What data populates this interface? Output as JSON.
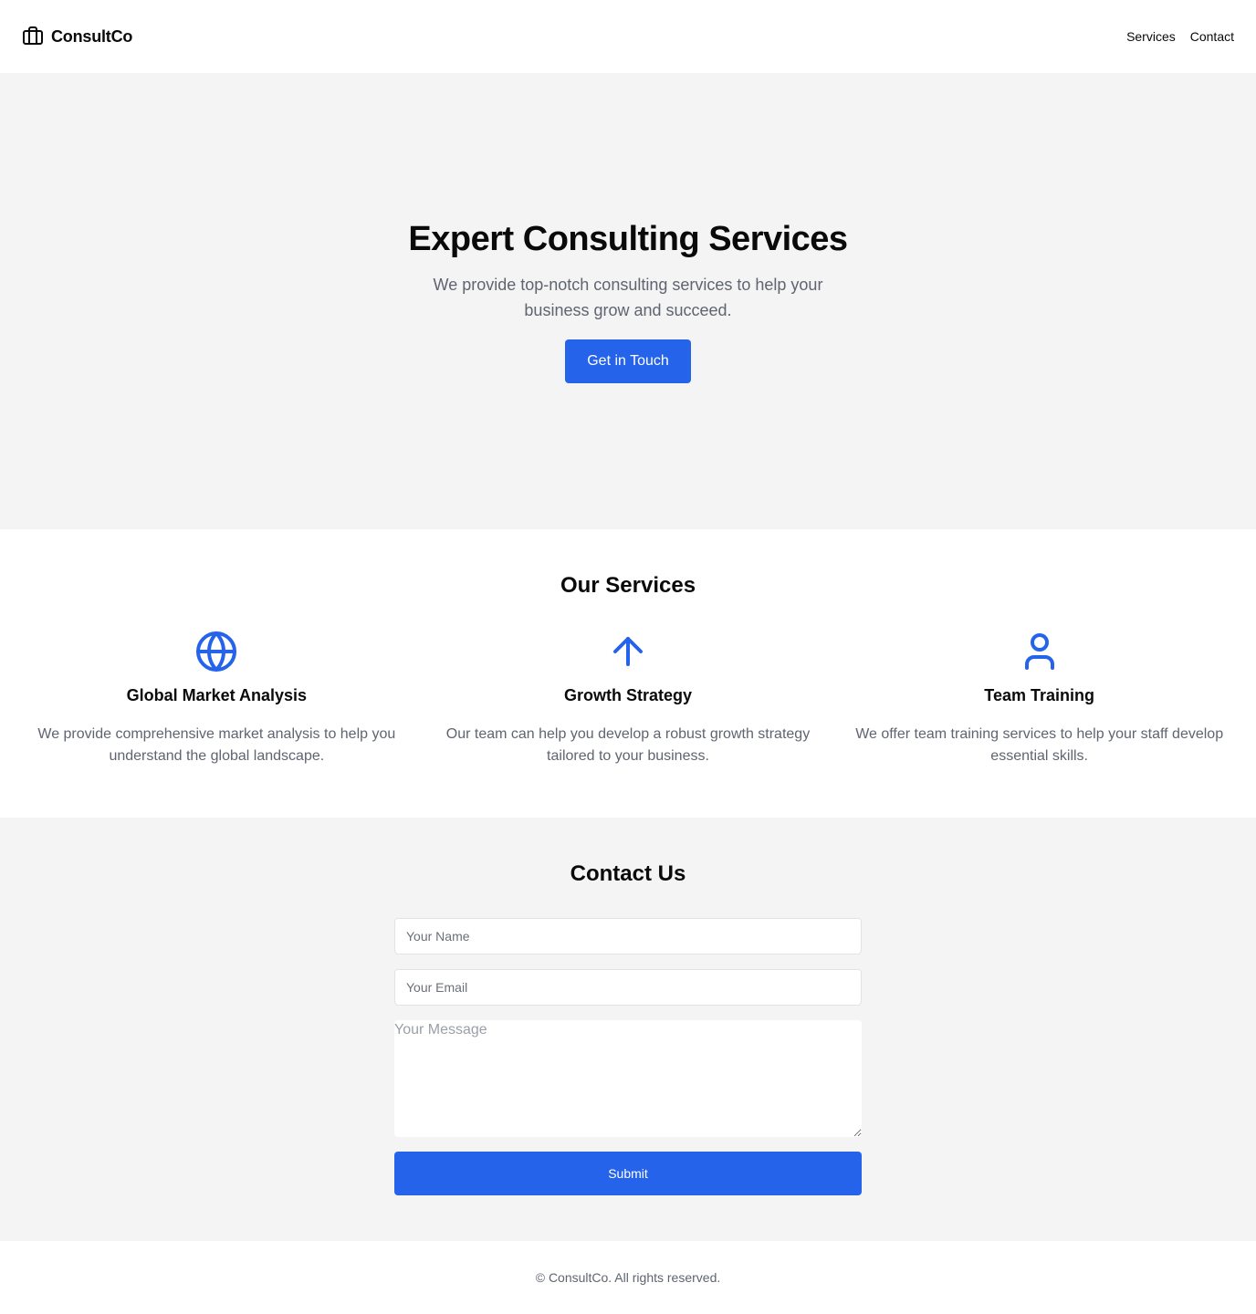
{
  "header": {
    "brand": "ConsultCo",
    "brand_icon": "briefcase-icon",
    "nav": [
      {
        "label": "Services"
      },
      {
        "label": "Contact"
      }
    ]
  },
  "hero": {
    "title": "Expert Consulting Services",
    "subtitle": "We provide top-notch consulting services to help your business grow and succeed.",
    "cta_label": "Get in Touch"
  },
  "services": {
    "title": "Our Services",
    "items": [
      {
        "icon": "globe-icon",
        "title": "Global Market Analysis",
        "description": "We provide comprehensive market analysis to help you understand the global landscape."
      },
      {
        "icon": "arrow-up-icon",
        "title": "Growth Strategy",
        "description": "Our team can help you develop a robust growth strategy tailored to your business."
      },
      {
        "icon": "user-icon",
        "title": "Team Training",
        "description": "We offer team training services to help your staff develop essential skills."
      }
    ]
  },
  "contact": {
    "title": "Contact Us",
    "name_placeholder": "Your Name",
    "email_placeholder": "Your Email",
    "message_placeholder": "Your Message",
    "submit_label": "Submit"
  },
  "footer": {
    "text": "© ConsultCo. All rights reserved."
  },
  "colors": {
    "accent": "#2563eb",
    "background_alt": "#f4f4f4",
    "text_primary": "#0a0a0a",
    "text_muted": "#5f6470"
  }
}
